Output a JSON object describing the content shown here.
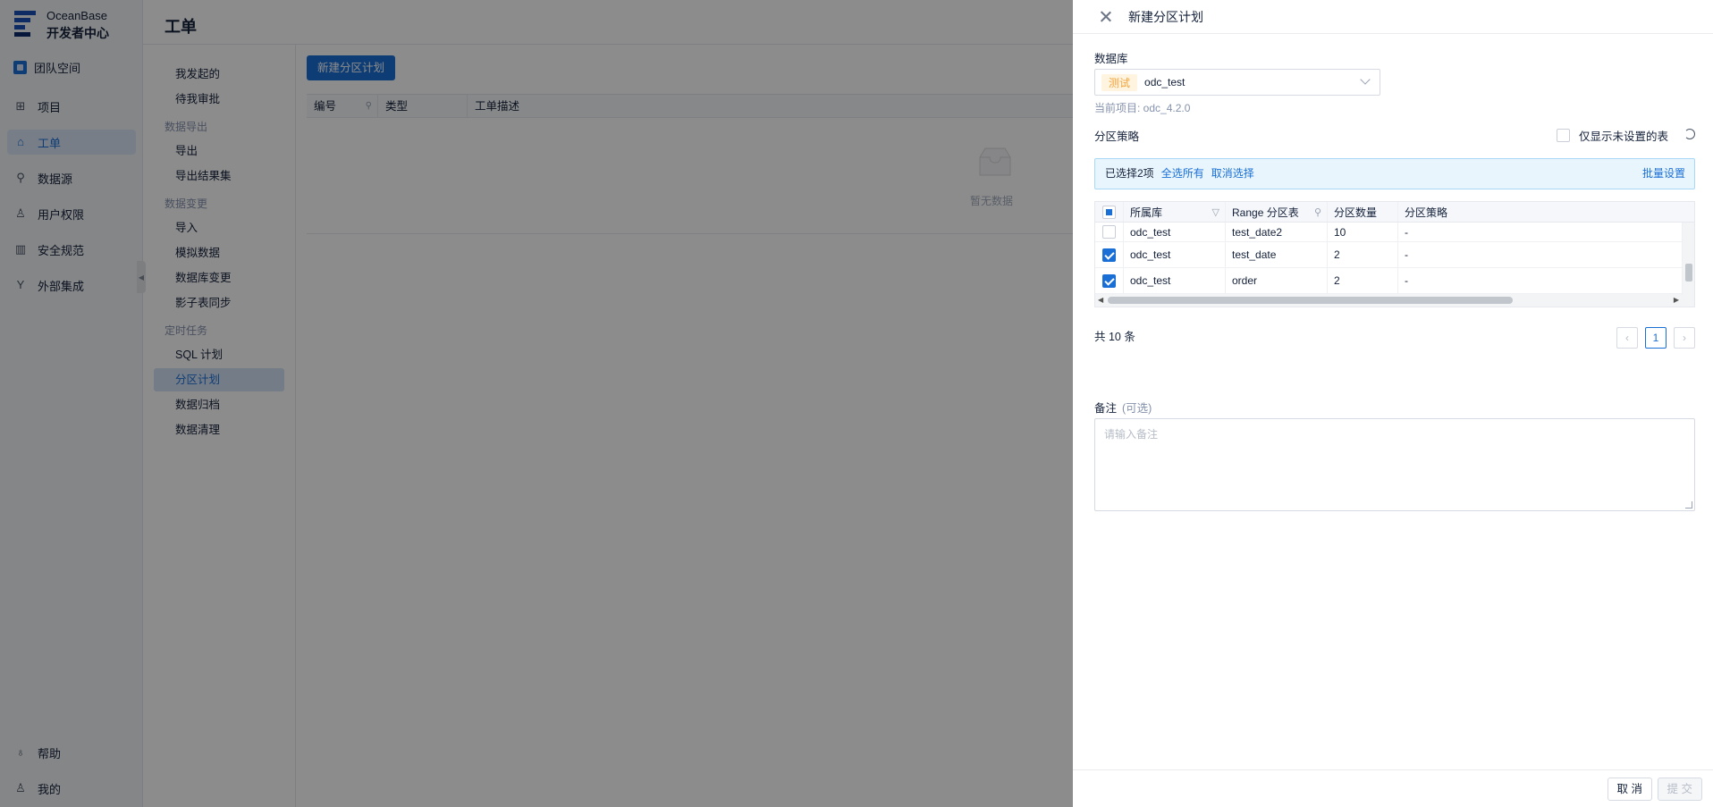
{
  "app": {
    "brand_line1": "OceanBase",
    "brand_line2": "开发者中心",
    "team": "团队空间",
    "nav": [
      {
        "label": "项目",
        "icon": "grid-icon"
      },
      {
        "label": "工单",
        "icon": "briefcase-icon"
      },
      {
        "label": "数据源",
        "icon": "plug-icon"
      },
      {
        "label": "用户权限",
        "icon": "user-key-icon"
      },
      {
        "label": "安全规范",
        "icon": "chart-box-icon"
      },
      {
        "label": "外部集成",
        "icon": "fork-icon"
      }
    ],
    "nav_bottom": [
      {
        "label": "帮助",
        "icon": "bulb-icon"
      },
      {
        "label": "我的",
        "icon": "user-icon"
      }
    ]
  },
  "page": {
    "title": "工单",
    "sub_nav": {
      "top": [
        "我发起的",
        "待我审批"
      ],
      "groups": [
        {
          "title": "数据导出",
          "items": [
            "导出",
            "导出结果集"
          ]
        },
        {
          "title": "数据变更",
          "items": [
            "导入",
            "模拟数据",
            "数据库变更",
            "影子表同步"
          ]
        },
        {
          "title": "定时任务",
          "items": [
            "SQL 计划",
            "分区计划",
            "数据归档",
            "数据清理"
          ]
        }
      ]
    },
    "new_button": "新建分区计划",
    "list_columns": [
      "编号",
      "类型",
      "工单描述"
    ],
    "empty_text": "暂无数据"
  },
  "drawer": {
    "title": "新建分区计划",
    "database_label": "数据库",
    "env_tag": "测试",
    "database_value": "odc_test",
    "project_hint": "当前项目: odc_4.2.0",
    "strategy_label": "分区策略",
    "only_unset_label": "仅显示未设置的表",
    "alert": {
      "selected": "已选择2项",
      "select_all": "全选所有",
      "deselect": "取消选择",
      "batch": "批量设置"
    },
    "table": {
      "columns": [
        "所属库",
        "Range 分区表",
        "分区数量",
        "分区策略"
      ],
      "rows": [
        {
          "db": "odc_test",
          "table": "test_date2",
          "count": "10",
          "strategy": "-",
          "checked": false
        },
        {
          "db": "odc_test",
          "table": "test_date",
          "count": "2",
          "strategy": "-",
          "checked": true
        },
        {
          "db": "odc_test",
          "table": "order",
          "count": "2",
          "strategy": "-",
          "checked": true
        }
      ]
    },
    "total": "共 10 条",
    "page_current": "1",
    "note_label": "备注",
    "note_optional": "(可选)",
    "note_placeholder": "请输入备注",
    "cancel": "取 消",
    "submit": "提 交"
  }
}
